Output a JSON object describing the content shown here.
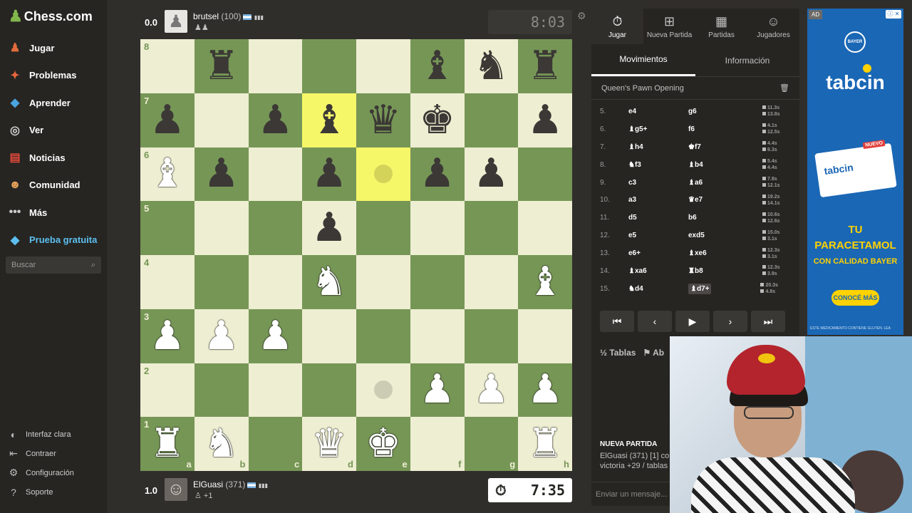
{
  "sidebar": {
    "logo_text": "Chess.com",
    "items": [
      {
        "label": "Jugar",
        "icon": "play-pawn-icon",
        "glyph": "♟",
        "color": "#e26b3b"
      },
      {
        "label": "Problemas",
        "icon": "puzzle-icon",
        "glyph": "✦",
        "color": "#e8663c"
      },
      {
        "label": "Aprender",
        "icon": "learn-cube-icon",
        "glyph": "◆",
        "color": "#4aa3df"
      },
      {
        "label": "Ver",
        "icon": "binoculars-icon",
        "glyph": "◎",
        "color": "#cfcecd"
      },
      {
        "label": "Noticias",
        "icon": "news-icon",
        "glyph": "▤",
        "color": "#e2493b"
      },
      {
        "label": "Comunidad",
        "icon": "community-icon",
        "glyph": "☻",
        "color": "#e8a35c"
      },
      {
        "label": "Más",
        "icon": "more-dots-icon",
        "glyph": "•••",
        "color": "#cfcecd"
      },
      {
        "label": "Prueba gratuita",
        "icon": "diamond-icon",
        "glyph": "◆",
        "color": "#5dbfef"
      }
    ],
    "search_placeholder": "Buscar",
    "bottom_items": [
      {
        "label": "Interfaz clara",
        "icon": "contrast-icon",
        "glyph": "◐"
      },
      {
        "label": "Contraer",
        "icon": "collapse-icon",
        "glyph": "⇤"
      },
      {
        "label": "Configuración",
        "icon": "gear-icon",
        "glyph": "⚙"
      },
      {
        "label": "Soporte",
        "icon": "help-icon",
        "glyph": "?"
      }
    ]
  },
  "top_player": {
    "score": "0.0",
    "name": "brutsel",
    "rating": "(100)",
    "clock": "8:03",
    "signal": "▮▮▮"
  },
  "bottom_player": {
    "score": "1.0",
    "name": "ElGuasi",
    "rating": "(371)",
    "captured": "+1",
    "clock": "7:35",
    "signal": "▮▮▮"
  },
  "board": {
    "ranks": [
      [
        "",
        "bR",
        "",
        "",
        "",
        "bB",
        "bN",
        "bR"
      ],
      [
        "bP",
        "",
        "bP",
        "bB",
        "bQ",
        "bK",
        "",
        "bP"
      ],
      [
        "wB",
        "bP",
        "",
        "bP",
        "",
        "bP",
        "bP",
        ""
      ],
      [
        "",
        "",
        "",
        "bP",
        "",
        "",
        "",
        ""
      ],
      [
        "",
        "",
        "",
        "wN",
        "",
        "",
        "",
        "wB"
      ],
      [
        "wP",
        "wP",
        "wP",
        "",
        "",
        "",
        "",
        ""
      ],
      [
        "",
        "",
        "",
        "",
        "",
        "wP",
        "wP",
        "wP"
      ],
      [
        "wR",
        "wN",
        "",
        "wQ",
        "wK",
        "",
        "",
        "wR"
      ]
    ],
    "highlights": [
      "d7",
      "e6"
    ],
    "hints": [
      "e6",
      "e2"
    ],
    "rank_labels": [
      "8",
      "7",
      "6",
      "5",
      "4",
      "3",
      "2",
      "1"
    ],
    "file_labels": [
      "a",
      "b",
      "c",
      "d",
      "e",
      "f",
      "g",
      "h"
    ]
  },
  "panel": {
    "tabs": [
      {
        "label": "Jugar",
        "glyph": "⏱",
        "icon": "stopwatch-icon"
      },
      {
        "label": "Nueva Partida",
        "glyph": "⊞",
        "icon": "new-game-icon"
      },
      {
        "label": "Partidas",
        "glyph": "▦",
        "icon": "games-icon"
      },
      {
        "label": "Jugadores",
        "glyph": "☺",
        "icon": "players-icon"
      }
    ],
    "subtabs": [
      "Movimientos",
      "Información"
    ],
    "opening": "Queen's Pawn Opening",
    "moves": [
      {
        "num": "5.",
        "w": "e4",
        "b": "g6",
        "tw": "11.3s",
        "tb": "13.8s"
      },
      {
        "num": "6.",
        "w": "♝g5+",
        "b": "f6",
        "tw": "4.1s",
        "tb": "12.5s"
      },
      {
        "num": "7.",
        "w": "♝h4",
        "b": "♚f7",
        "tw": "4.4s",
        "tb": "6.3s"
      },
      {
        "num": "8.",
        "w": "♞f3",
        "b": "♝b4",
        "tw": "5.4s",
        "tb": "4.4s"
      },
      {
        "num": "9.",
        "w": "c3",
        "b": "♝a6",
        "tw": "7.8s",
        "tb": "12.1s"
      },
      {
        "num": "10.",
        "w": "a3",
        "b": "♛e7",
        "tw": "19.2s",
        "tb": "14.1s"
      },
      {
        "num": "11.",
        "w": "d5",
        "b": "b6",
        "tw": "10.6s",
        "tb": "12.6s"
      },
      {
        "num": "12.",
        "w": "e5",
        "b": "exd5",
        "tw": "15.0s",
        "tb": "3.1s"
      },
      {
        "num": "13.",
        "w": "e6+",
        "b": "♝xe6",
        "tw": "12.3s",
        "tb": "3.1s"
      },
      {
        "num": "14.",
        "w": "♝xa6",
        "b": "♜b8",
        "tw": "12.3s",
        "tb": "3.9s"
      },
      {
        "num": "15.",
        "w": "♞d4",
        "b": "♝d7+",
        "tw": "20.3s",
        "tb": "4.8s"
      }
    ],
    "actions": [
      "Tablas",
      "Ab"
    ],
    "chat_header": "NUEVA PARTIDA",
    "chat_line1": "ElGuasi (371) [1] co",
    "chat_line2": "victoria +29 / tablas",
    "chat_placeholder": "Enviar un mensaje..."
  },
  "ad": {
    "badge": "AD",
    "brand": "BAYER",
    "product": "tabcin",
    "box_text": "tabcin",
    "box_badge": "NUEVO",
    "slogan_line1": "TU PARACETAMOL",
    "slogan_line2": "CON CALIDAD BAYER",
    "cta": "CONOCÉ MÁS",
    "fine_print": "ESTE MEDICAMENTO CONTIENE GLUTEN. LEA"
  }
}
